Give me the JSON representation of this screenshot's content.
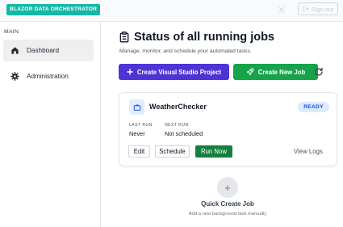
{
  "header": {
    "brand": "BLAZOR DATA ORCHESTRATOR",
    "sign_out_label": "Sign out"
  },
  "sidebar": {
    "section_label": "MAIN",
    "items": [
      {
        "label": "Dashboard",
        "icon": "home-icon",
        "active": true
      },
      {
        "label": "Administration",
        "icon": "gear-icon",
        "active": false
      }
    ]
  },
  "main": {
    "title": "Status of all running jobs",
    "subtitle": "Manage, monitor, and schedule your automated tasks.",
    "actions": {
      "create_vs_label": "Create Visual Studio Project",
      "create_job_label": "Create New Job"
    },
    "jobs": [
      {
        "name": "WeatherChecker",
        "status": "READY",
        "last_run_label": "LAST RUN",
        "last_run_value": "Never",
        "next_run_label": "NEXT RUN",
        "next_run_value": "Not scheduled",
        "edit_label": "Edit",
        "schedule_label": "Schedule",
        "run_label": "Run Now",
        "logs_label": "View Logs"
      }
    ],
    "quick_create": {
      "icon": "+",
      "title": "Quick Create Job",
      "subtitle": "Add a new background task manually"
    }
  },
  "colors": {
    "brand": "#14b8a6",
    "primary": "#4f33d6",
    "success": "#16a34a",
    "run": "#15803d",
    "badge_bg": "#dbeafe",
    "badge_text": "#1d4ed8"
  }
}
